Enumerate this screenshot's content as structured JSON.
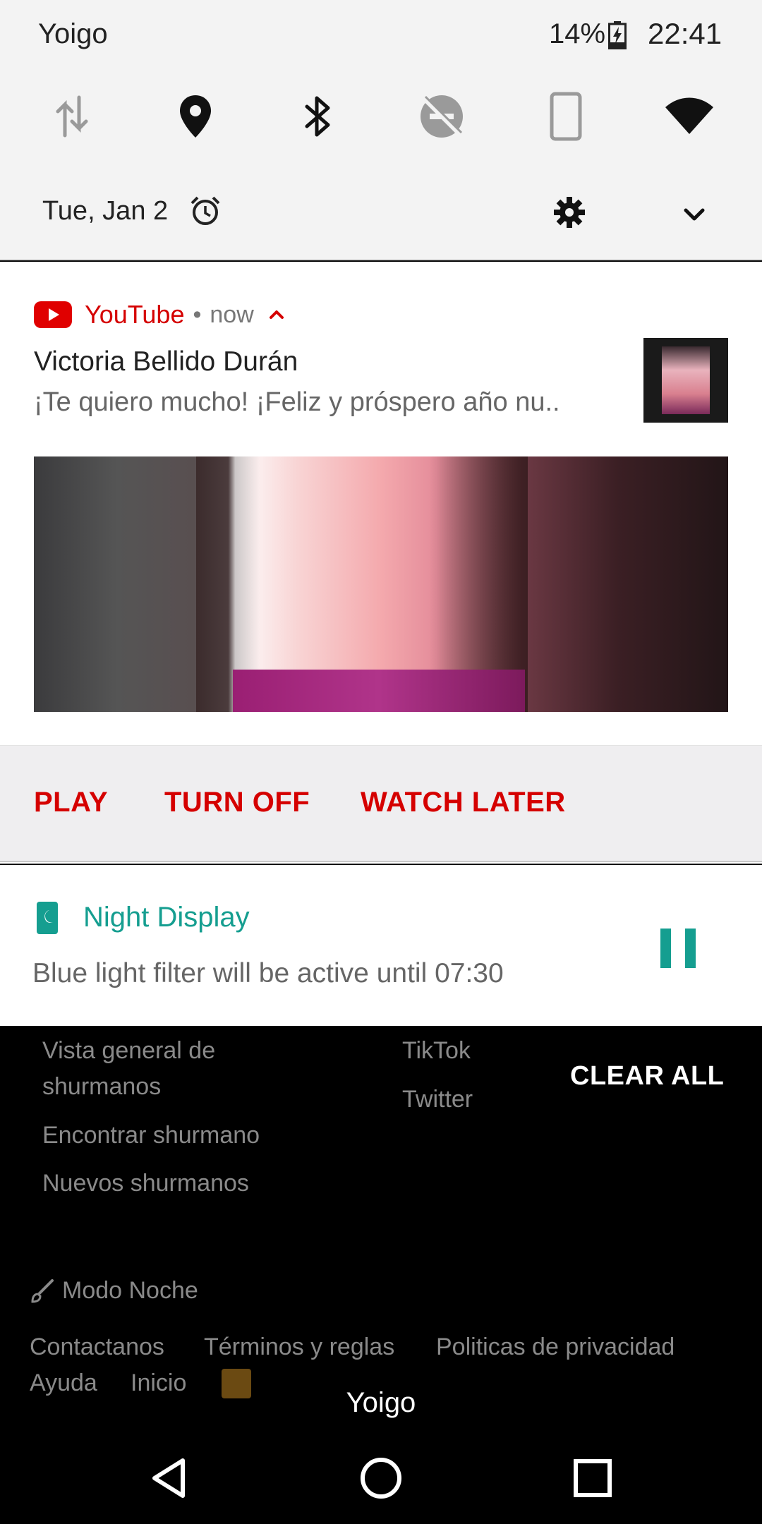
{
  "status_bar": {
    "carrier": "Yoigo",
    "battery": "14%",
    "time": "22:41"
  },
  "quick_settings": {
    "tiles": [
      {
        "name": "mobile-data-icon"
      },
      {
        "name": "location-icon"
      },
      {
        "name": "bluetooth-icon"
      },
      {
        "name": "do-not-disturb-icon"
      },
      {
        "name": "auto-rotate-icon"
      },
      {
        "name": "wifi-icon"
      }
    ],
    "date": "Tue, Jan 2"
  },
  "youtube_notification": {
    "app": "YouTube",
    "separator": "•",
    "time": "now",
    "title": "Victoria Bellido Durán",
    "body": "¡Te quiero mucho! ¡Feliz y próspero año nu..",
    "actions": {
      "play": "PLAY",
      "turn_off": "TURN OFF",
      "watch_later": "WATCH LATER"
    },
    "accent_color": "#d50000"
  },
  "night_display_notification": {
    "title": "Night Display",
    "body": "Blue light filter will be active until 07:30",
    "accent_color": "#159e90"
  },
  "background_page": {
    "links_left": [
      "Vista general de",
      "shurmanos",
      "Encontrar shurmano",
      "Nuevos shurmanos"
    ],
    "links_right": [
      "TikTok",
      "Twitter"
    ],
    "night_mode": "Modo Noche",
    "footer_row1": [
      "Contactanos",
      "Términos y reglas",
      "Politicas de privacidad"
    ],
    "footer_row2": [
      "Ayuda",
      "Inicio"
    ]
  },
  "clear_all": "CLEAR ALL",
  "bottom_carrier": "Yoigo"
}
